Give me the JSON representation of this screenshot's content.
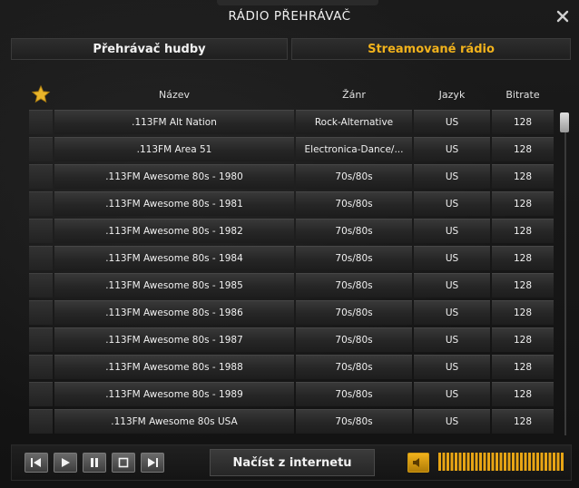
{
  "window": {
    "title": "RÁDIO PŘEHRÁVAČ"
  },
  "tabs": [
    {
      "label": "Přehrávač hudby",
      "active": false
    },
    {
      "label": "Streamované rádio",
      "active": true
    }
  ],
  "table": {
    "columns": {
      "name": "Název",
      "genre": "Žánr",
      "language": "Jazyk",
      "bitrate": "Bitrate"
    },
    "rows": [
      {
        "name": ".113FM Alt Nation",
        "genre": "Rock-Alternative",
        "language": "US",
        "bitrate": "128"
      },
      {
        "name": ".113FM Area 51",
        "genre": "Electronica-Dance/...",
        "language": "US",
        "bitrate": "128"
      },
      {
        "name": ".113FM Awesome 80s - 1980",
        "genre": "70s/80s",
        "language": "US",
        "bitrate": "128"
      },
      {
        "name": ".113FM Awesome 80s - 1981",
        "genre": "70s/80s",
        "language": "US",
        "bitrate": "128"
      },
      {
        "name": ".113FM Awesome 80s - 1982",
        "genre": "70s/80s",
        "language": "US",
        "bitrate": "128"
      },
      {
        "name": ".113FM Awesome 80s - 1984",
        "genre": "70s/80s",
        "language": "US",
        "bitrate": "128"
      },
      {
        "name": ".113FM Awesome 80s - 1985",
        "genre": "70s/80s",
        "language": "US",
        "bitrate": "128"
      },
      {
        "name": ".113FM Awesome 80s - 1986",
        "genre": "70s/80s",
        "language": "US",
        "bitrate": "128"
      },
      {
        "name": ".113FM Awesome 80s - 1987",
        "genre": "70s/80s",
        "language": "US",
        "bitrate": "128"
      },
      {
        "name": ".113FM Awesome 80s - 1988",
        "genre": "70s/80s",
        "language": "US",
        "bitrate": "128"
      },
      {
        "name": ".113FM Awesome 80s - 1989",
        "genre": "70s/80s",
        "language": "US",
        "bitrate": "128"
      },
      {
        "name": ".113FM Awesome 80s USA",
        "genre": "70s/80s",
        "language": "US",
        "bitrate": "128"
      }
    ]
  },
  "controls": {
    "load_from_internet": "Načíst z internetu",
    "volume_fraction": 1.0
  },
  "icons": {
    "close": "close-icon",
    "favorite_header": "star-icon",
    "previous": "skip-previous-icon",
    "play": "play-icon",
    "pause": "pause-icon",
    "stop": "stop-icon",
    "next": "skip-next-icon",
    "volume": "speaker-icon"
  },
  "colors": {
    "accent": "#f1b21c",
    "text": "#f0f0f0",
    "background": "#141414"
  }
}
